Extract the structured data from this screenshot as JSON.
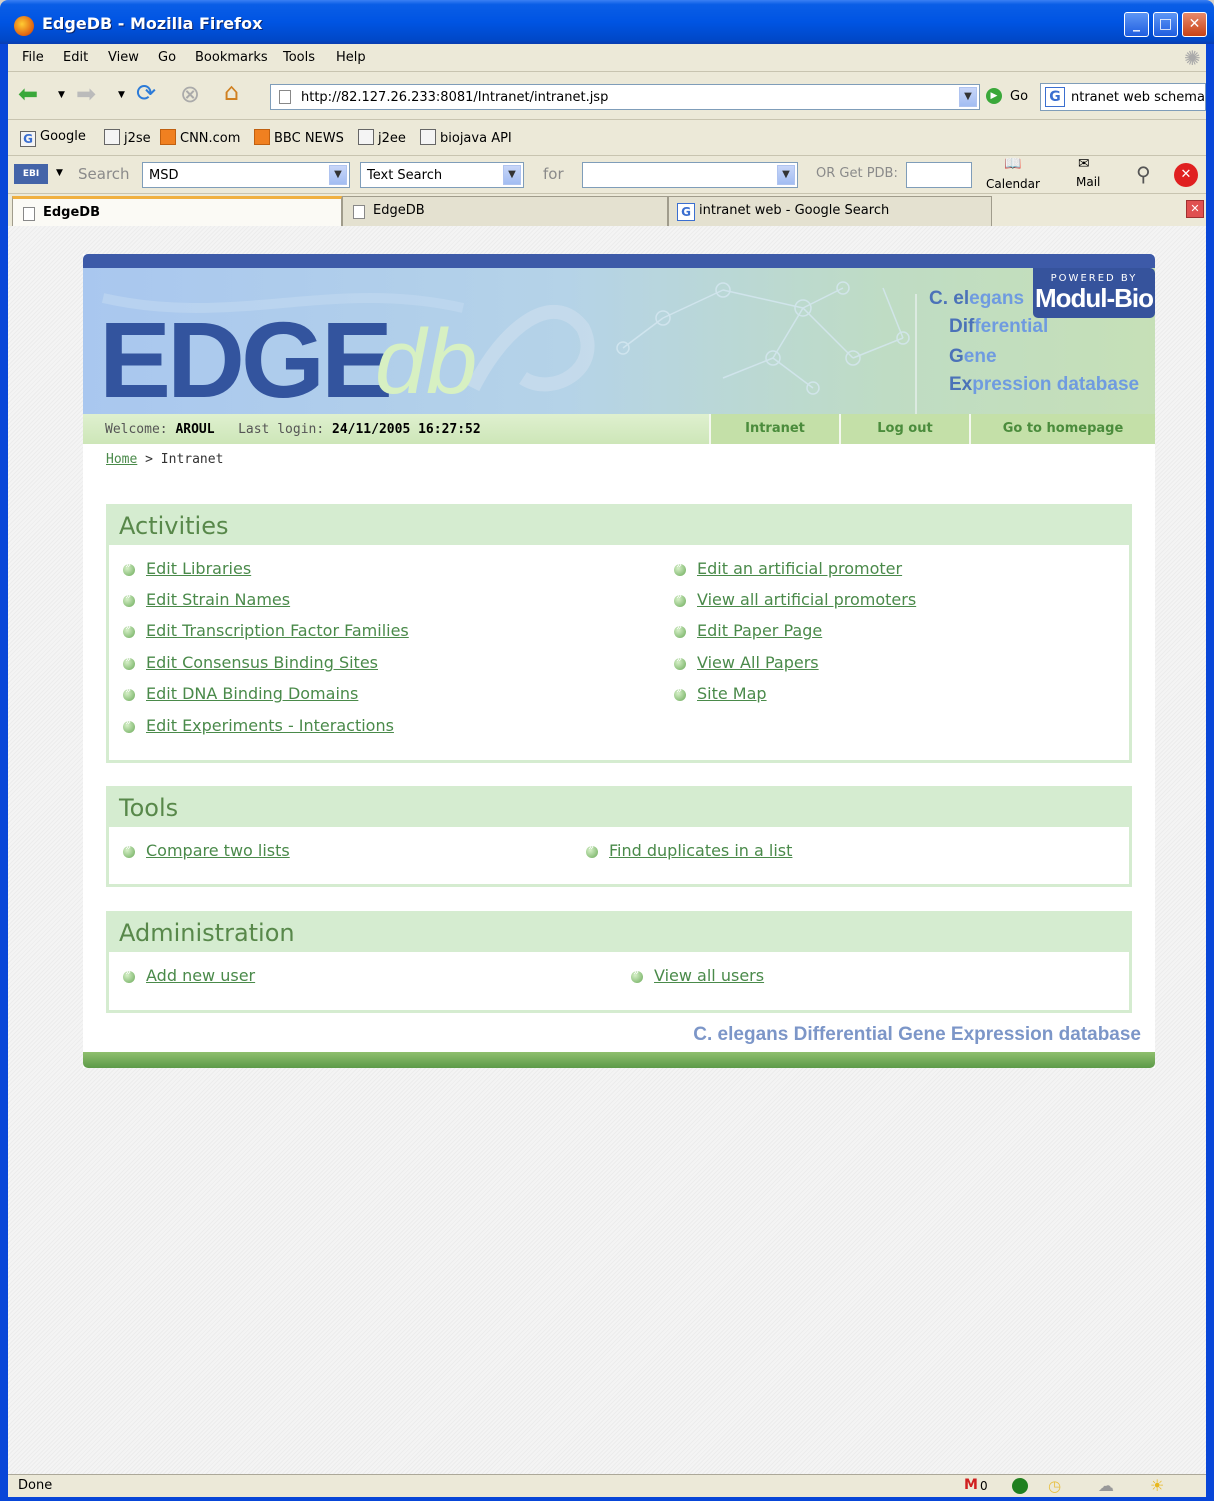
{
  "window": {
    "title": "EdgeDB - Mozilla Firefox"
  },
  "menu": [
    "File",
    "Edit",
    "View",
    "Go",
    "Bookmarks",
    "Tools",
    "Help"
  ],
  "nav": {
    "url": "http://82.127.26.233:8081/Intranet/intranet.jsp",
    "go_label": "Go",
    "search_value": "ntranet web schema"
  },
  "bookmarks": [
    "Google",
    "j2se",
    "CNN.com",
    "BBC NEWS",
    "j2ee",
    "biojava API"
  ],
  "ebi": {
    "search_label": "Search",
    "db_value": "MSD",
    "type_value": "Text Search",
    "for_label": "for",
    "pdb_label": "OR Get PDB:",
    "calendar_label": "Calendar",
    "mail_label": "Mail"
  },
  "tabs": [
    {
      "label": "EdgeDB"
    },
    {
      "label": "EdgeDB"
    },
    {
      "label": "intranet web - Google Search"
    }
  ],
  "banner": {
    "logo_main": "EDGE",
    "logo_sub": "db",
    "powered_by": "POWERED BY",
    "brand": "Modul-Bio",
    "tagline": [
      {
        "first": "C. el",
        "rest": "egans"
      },
      {
        "first": "Dif",
        "rest": "ferential"
      },
      {
        "first": "G",
        "rest": "ene"
      },
      {
        "first": "Ex",
        "rest": "pression database"
      }
    ]
  },
  "user": {
    "welcome_label": "Welcome:",
    "name": "AROUL",
    "last_login_label": "Last login:",
    "last_login": "24/11/2005 16:27:52"
  },
  "topnav": [
    "Intranet",
    "Log out",
    "Go to homepage"
  ],
  "breadcrumb": {
    "home": "Home",
    "sep": ">",
    "current": "Intranet"
  },
  "sections": {
    "activities": {
      "title": "Activities",
      "left": [
        "Edit Libraries",
        "Edit Strain Names",
        "Edit Transcription Factor Families",
        "Edit Consensus Binding Sites",
        "Edit DNA Binding Domains",
        "Edit Experiments - Interactions"
      ],
      "right": [
        "Edit an artificial promoter",
        "View all artificial promoters",
        "Edit Paper Page",
        "View All Papers",
        "Site Map"
      ]
    },
    "tools": {
      "title": "Tools",
      "items": [
        "Compare two lists",
        "Find duplicates in a list"
      ]
    },
    "administration": {
      "title": "Administration",
      "items": [
        "Add new user",
        "View all users"
      ]
    }
  },
  "footer": "C. elegans Differential Gene Expression database",
  "status": {
    "text": "Done",
    "mail_count": "0"
  }
}
